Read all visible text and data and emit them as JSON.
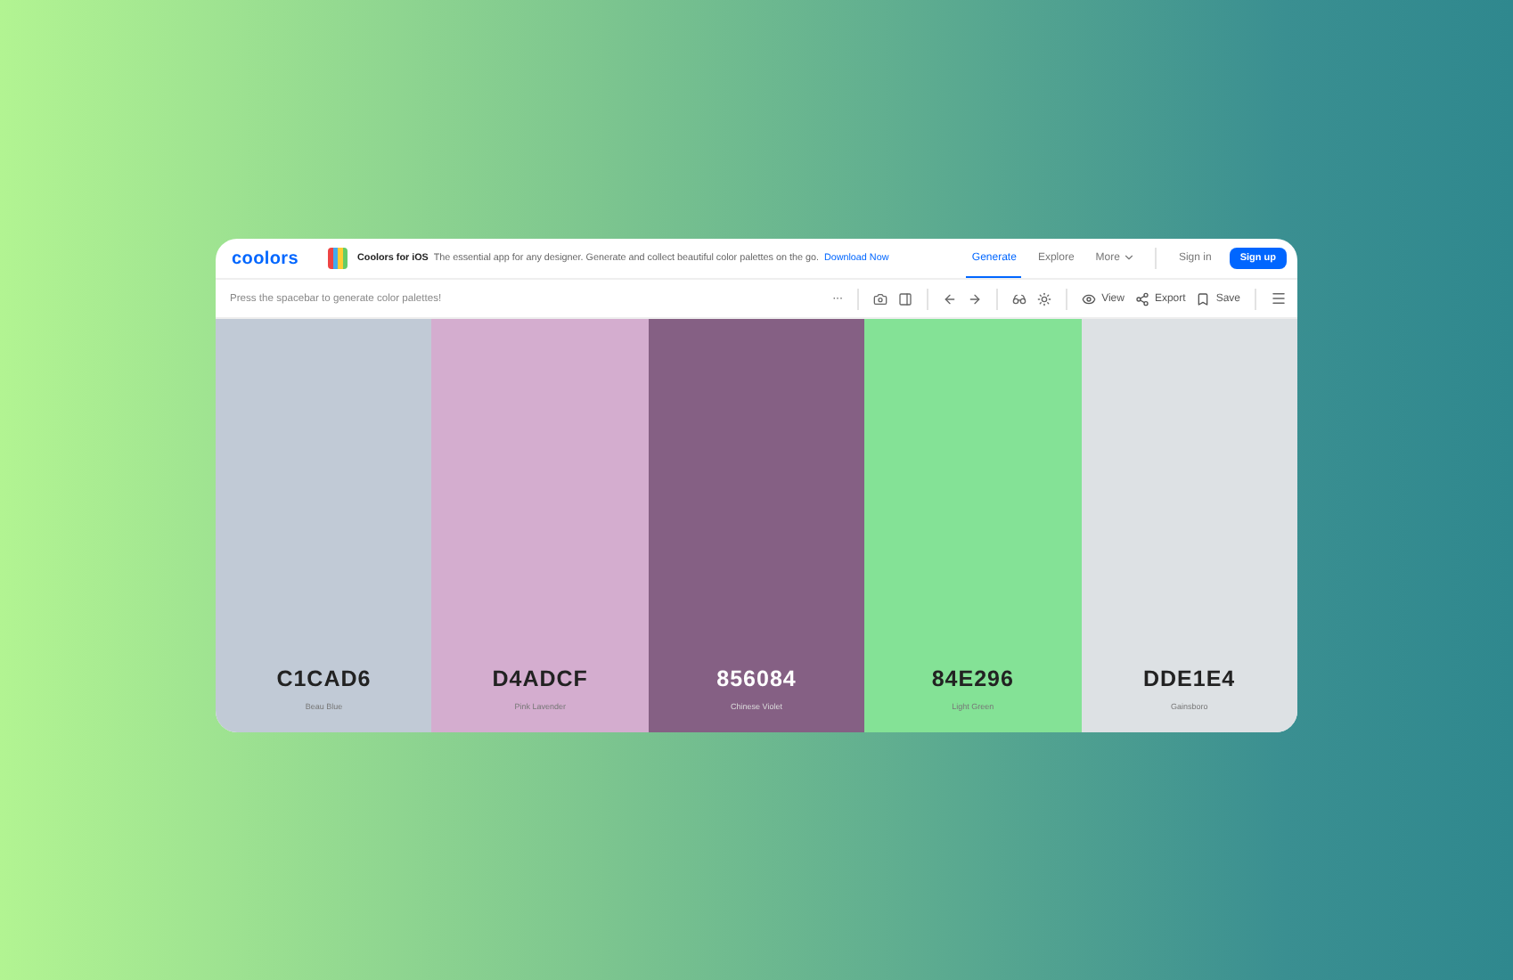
{
  "logo": "coolors",
  "promo": {
    "title": "Coolors for iOS",
    "text": "The essential app for any designer. Generate and collect beautiful color palettes on the go.",
    "link": "Download Now"
  },
  "nav": [
    {
      "label": "Generate",
      "selected": true
    },
    {
      "label": "Explore",
      "selected": false
    },
    {
      "label": "More",
      "selected": false
    }
  ],
  "sign_in": "Sign in",
  "sign_up": "Sign up",
  "hint": "Press the spacebar to generate color palettes!",
  "toolbar": {
    "more": "···",
    "view": "View",
    "export": "Export",
    "save": "Save"
  },
  "palette": [
    {
      "hex": "C1CAD6",
      "name": "Beau Blue",
      "color": "#c1cad6"
    },
    {
      "hex": "D4ADCF",
      "name": "Pink Lavender",
      "color": "#d4adcf"
    },
    {
      "hex": "856084",
      "name": "Chinese Violet",
      "color": "#856084"
    },
    {
      "hex": "84E296",
      "name": "Light Green",
      "color": "#84e296"
    },
    {
      "hex": "DDE1E4",
      "name": "Gainsboro",
      "color": "#dde1e4"
    }
  ]
}
